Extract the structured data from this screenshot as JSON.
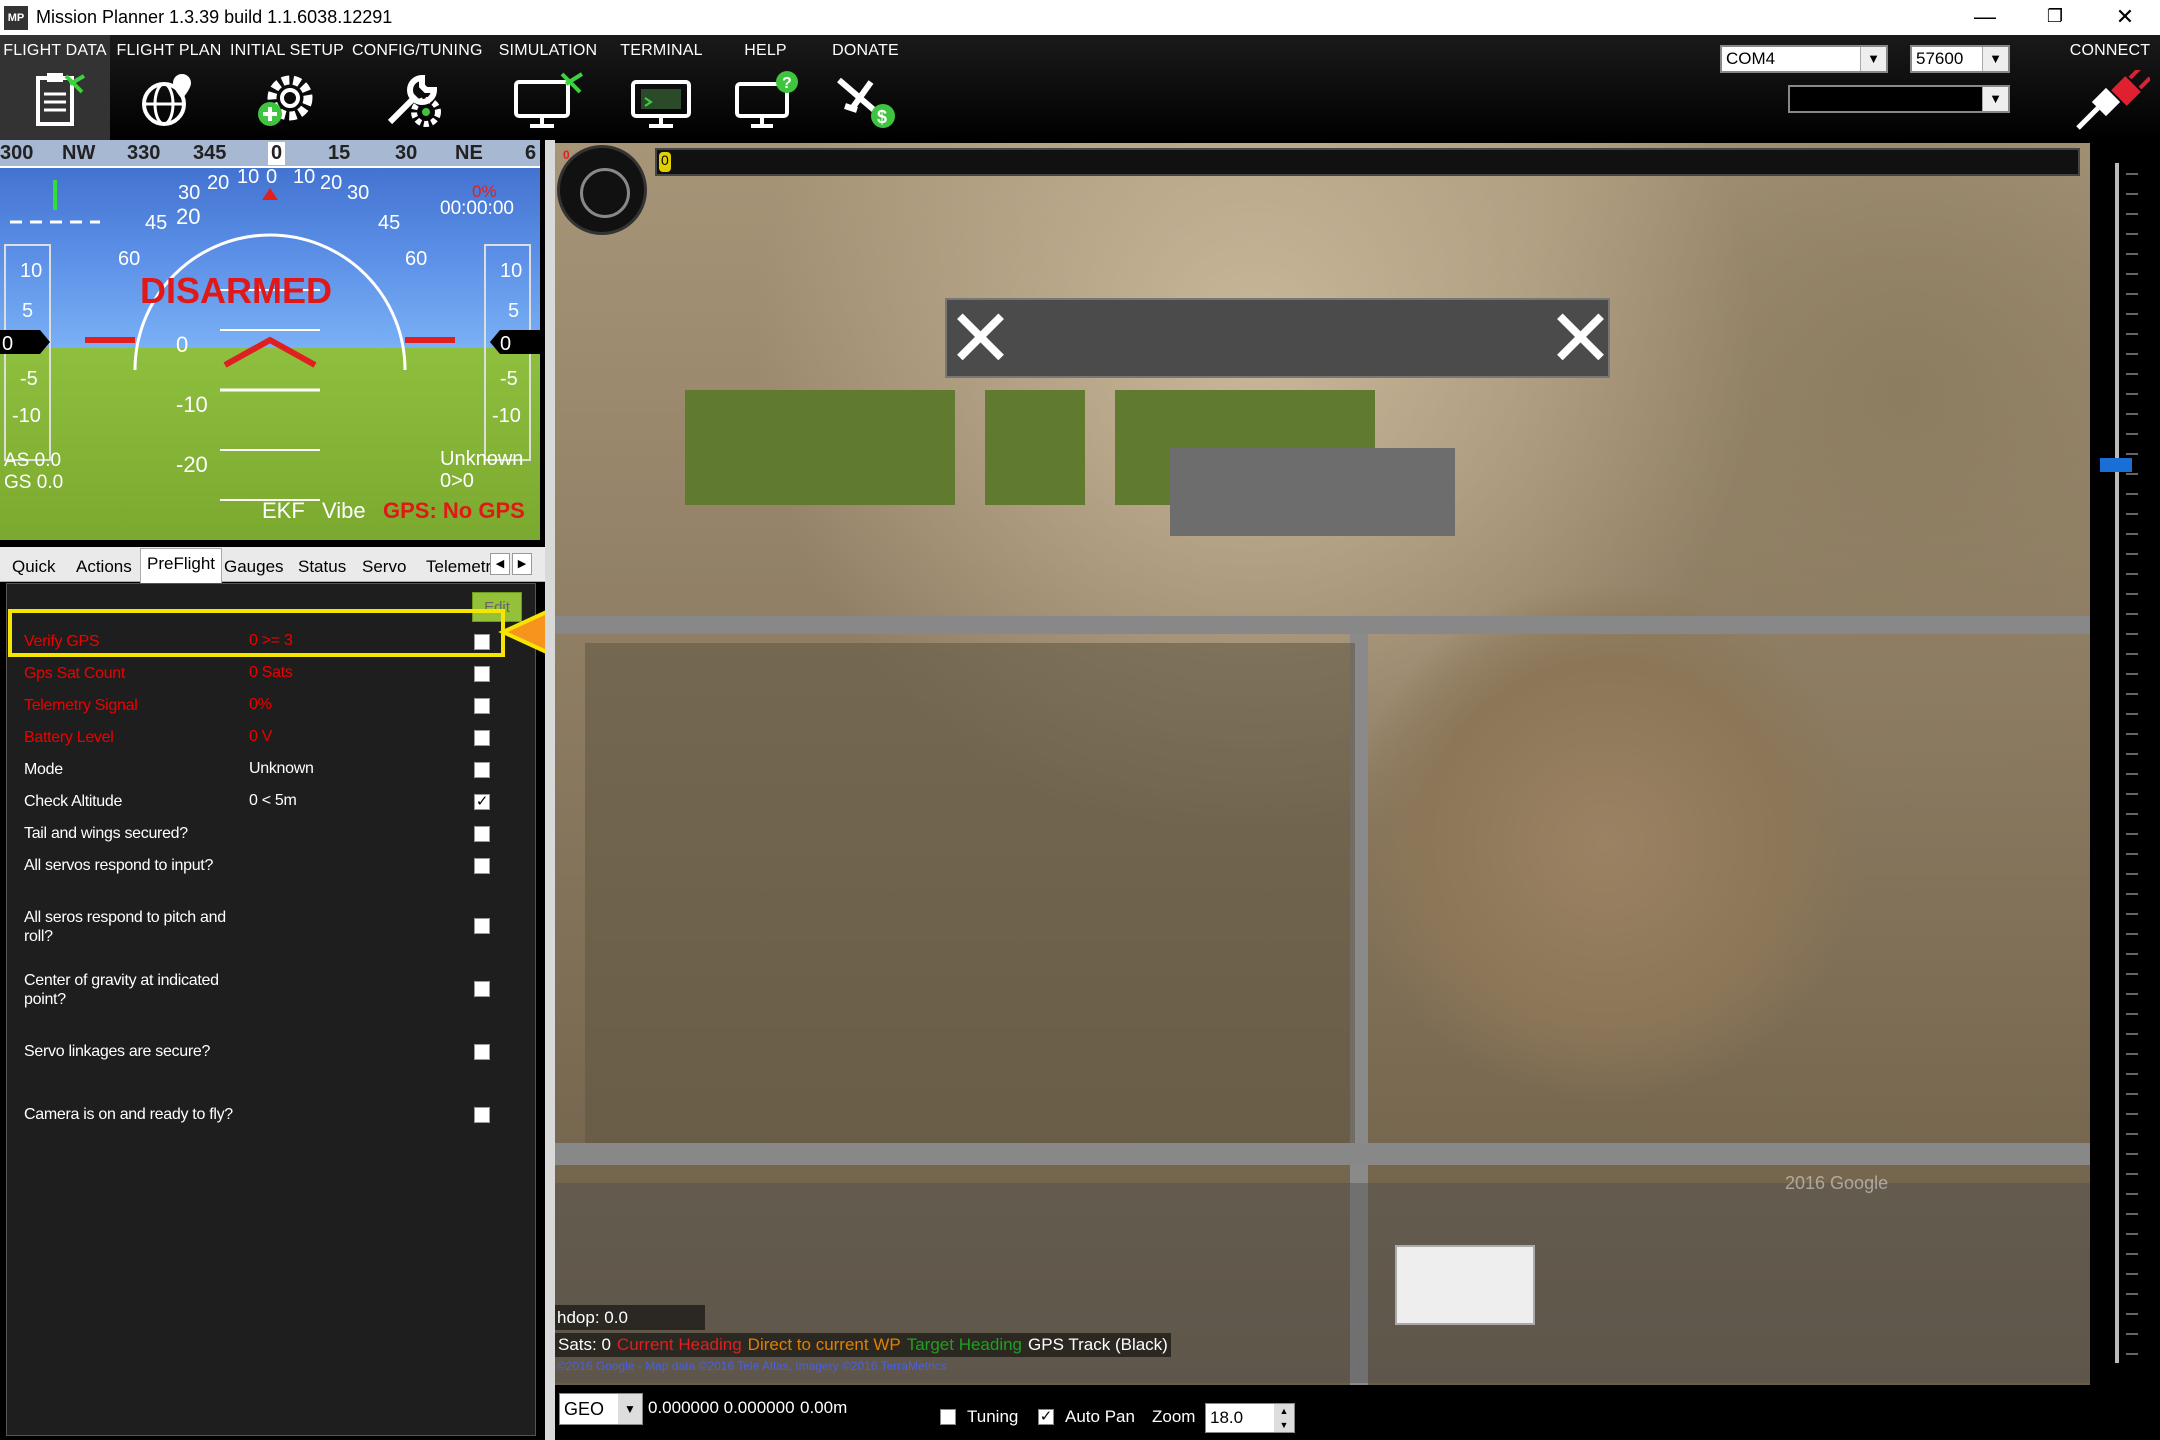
{
  "window": {
    "title": "Mission Planner 1.3.39 build 1.1.6038.12291",
    "app_icon": "MP"
  },
  "menu": [
    {
      "label": "FLIGHT DATA",
      "icon": "clipboard-plane-icon"
    },
    {
      "label": "FLIGHT PLAN",
      "icon": "globe-pin-icon"
    },
    {
      "label": "INITIAL SETUP",
      "icon": "gear-plus-icon"
    },
    {
      "label": "CONFIG/TUNING",
      "icon": "wrench-gear-icon"
    },
    {
      "label": "SIMULATION",
      "icon": "monitor-plane-icon"
    },
    {
      "label": "TERMINAL",
      "icon": "monitor-terminal-icon"
    },
    {
      "label": "HELP",
      "icon": "monitor-help-icon"
    },
    {
      "label": "DONATE",
      "icon": "plane-dollar-icon"
    }
  ],
  "connection": {
    "port": "COM4",
    "baud": "57600",
    "profile": "",
    "connect_label": "CONNECT"
  },
  "hud": {
    "compass": [
      "300",
      "NW",
      "330",
      "345",
      "0",
      "15",
      "30",
      "NE",
      "6"
    ],
    "armed_status": "DISARMED",
    "left_scale": [
      "10",
      "5",
      "0",
      "-5",
      "-10"
    ],
    "right_scale": [
      "10",
      "5",
      "0",
      "-5",
      "-10"
    ],
    "pitch_labels": [
      "20",
      "0",
      "-10",
      "-20"
    ],
    "roll_labels": [
      "60",
      "45",
      "30",
      "20",
      "10",
      "0",
      "10",
      "20",
      "30",
      "45",
      "60"
    ],
    "airspeed": "AS 0.0",
    "groundspeed": "GS 0.0",
    "battery_pct": "0%",
    "timer": "00:00:00",
    "mode": "Unknown",
    "wp": "0>0",
    "ekf": "EKF",
    "vibe": "Vibe",
    "gps": "GPS: No GPS"
  },
  "tabs": [
    "Quick",
    "Actions",
    "PreFlight",
    "Gauges",
    "Status",
    "Servo",
    "Telemetr"
  ],
  "active_tab": "PreFlight",
  "checklist": {
    "edit_label": "Edit",
    "items": [
      {
        "desc": "Verify GPS",
        "value": "0 >= 3",
        "checked": false,
        "fail": true
      },
      {
        "desc": "Gps Sat Count",
        "value": "0 Sats",
        "checked": false,
        "fail": true
      },
      {
        "desc": "Telemetry Signal",
        "value": "0%",
        "checked": false,
        "fail": true
      },
      {
        "desc": "Battery Level",
        "value": "0 V",
        "checked": false,
        "fail": true
      },
      {
        "desc": "Mode",
        "value": "Unknown",
        "checked": false,
        "fail": false
      },
      {
        "desc": "Check Altitude",
        "value": "0 < 5m",
        "checked": true,
        "fail": false
      },
      {
        "desc": "Tail and wings secured?",
        "value": "",
        "checked": false,
        "fail": false
      },
      {
        "desc": "All servos respond to input?",
        "value": "",
        "checked": false,
        "fail": false
      },
      {
        "desc": "All seros respond to pitch and roll?",
        "value": "",
        "checked": false,
        "fail": false
      },
      {
        "desc": "Center of gravity at indicated point?",
        "value": "",
        "checked": false,
        "fail": false
      },
      {
        "desc": "Servo linkages are secure?",
        "value": "",
        "checked": false,
        "fail": false
      },
      {
        "desc": "Camera is on and ready to fly?",
        "value": "",
        "checked": false,
        "fail": false
      }
    ]
  },
  "map": {
    "camera_zero": "0",
    "progress_value": "0",
    "hdop": "hdop: 0.0",
    "legend": [
      {
        "text": "Sats: 0",
        "color": "#ffffff"
      },
      {
        "text": "Current Heading",
        "color": "#e02020"
      },
      {
        "text": "Direct to current WP",
        "color": "#e08000"
      },
      {
        "text": "Target Heading",
        "color": "#20a020"
      },
      {
        "text": "GPS Track (Black)",
        "color": "#ffffff"
      }
    ],
    "copyright": "©2016 Google - Map data ©2016 Tele Atlas, Imagery ©2016 TerraMetrics",
    "watermark": "2016 Google"
  },
  "statusbar": {
    "coord_system": "GEO",
    "coords": "0.000000 0.000000",
    "alt": "0.00m",
    "tuning_label": "Tuning",
    "tuning_checked": false,
    "autopan_label": "Auto Pan",
    "autopan_checked": true,
    "zoom_label": "Zoom",
    "zoom_value": "18.0"
  },
  "colors": {
    "highlight": "#f6e500",
    "arrow": "#f7941d",
    "fail_text": "#e00000",
    "edit_button": "#94c13a"
  }
}
